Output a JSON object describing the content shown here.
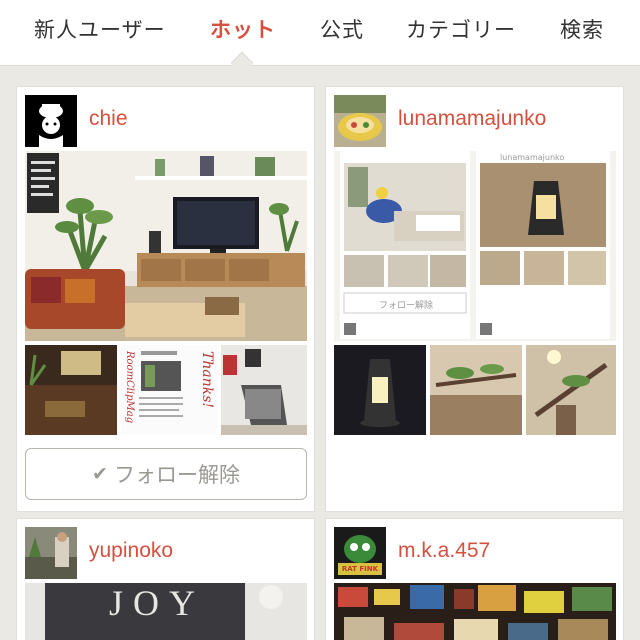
{
  "nav": {
    "tabs": [
      {
        "label": "新人ユーザー"
      },
      {
        "label": "ホット"
      },
      {
        "label": "公式"
      },
      {
        "label": "カテゴリー"
      },
      {
        "label": "検索"
      }
    ],
    "active_tab": "ホット"
  },
  "cards": [
    {
      "username": "chie",
      "follow_label": "フォロー解除",
      "follow_icon": "check-icon",
      "thumbnail_texts": [
        "RoomClipMag",
        "Thanks!"
      ]
    },
    {
      "username": "lunamamajunko",
      "inner_follow_label": "フォロー解除",
      "inner_username": "lunamamajunko"
    },
    {
      "username": "yupinoko",
      "photo_text": "JOY"
    },
    {
      "username": "m.k.a.457",
      "avatar_text": "RAT FINK"
    }
  ],
  "colors": {
    "accent": "#d5503f",
    "background": "#ebe9e4",
    "card": "#ffffff",
    "button_border": "#b9b6b0"
  }
}
